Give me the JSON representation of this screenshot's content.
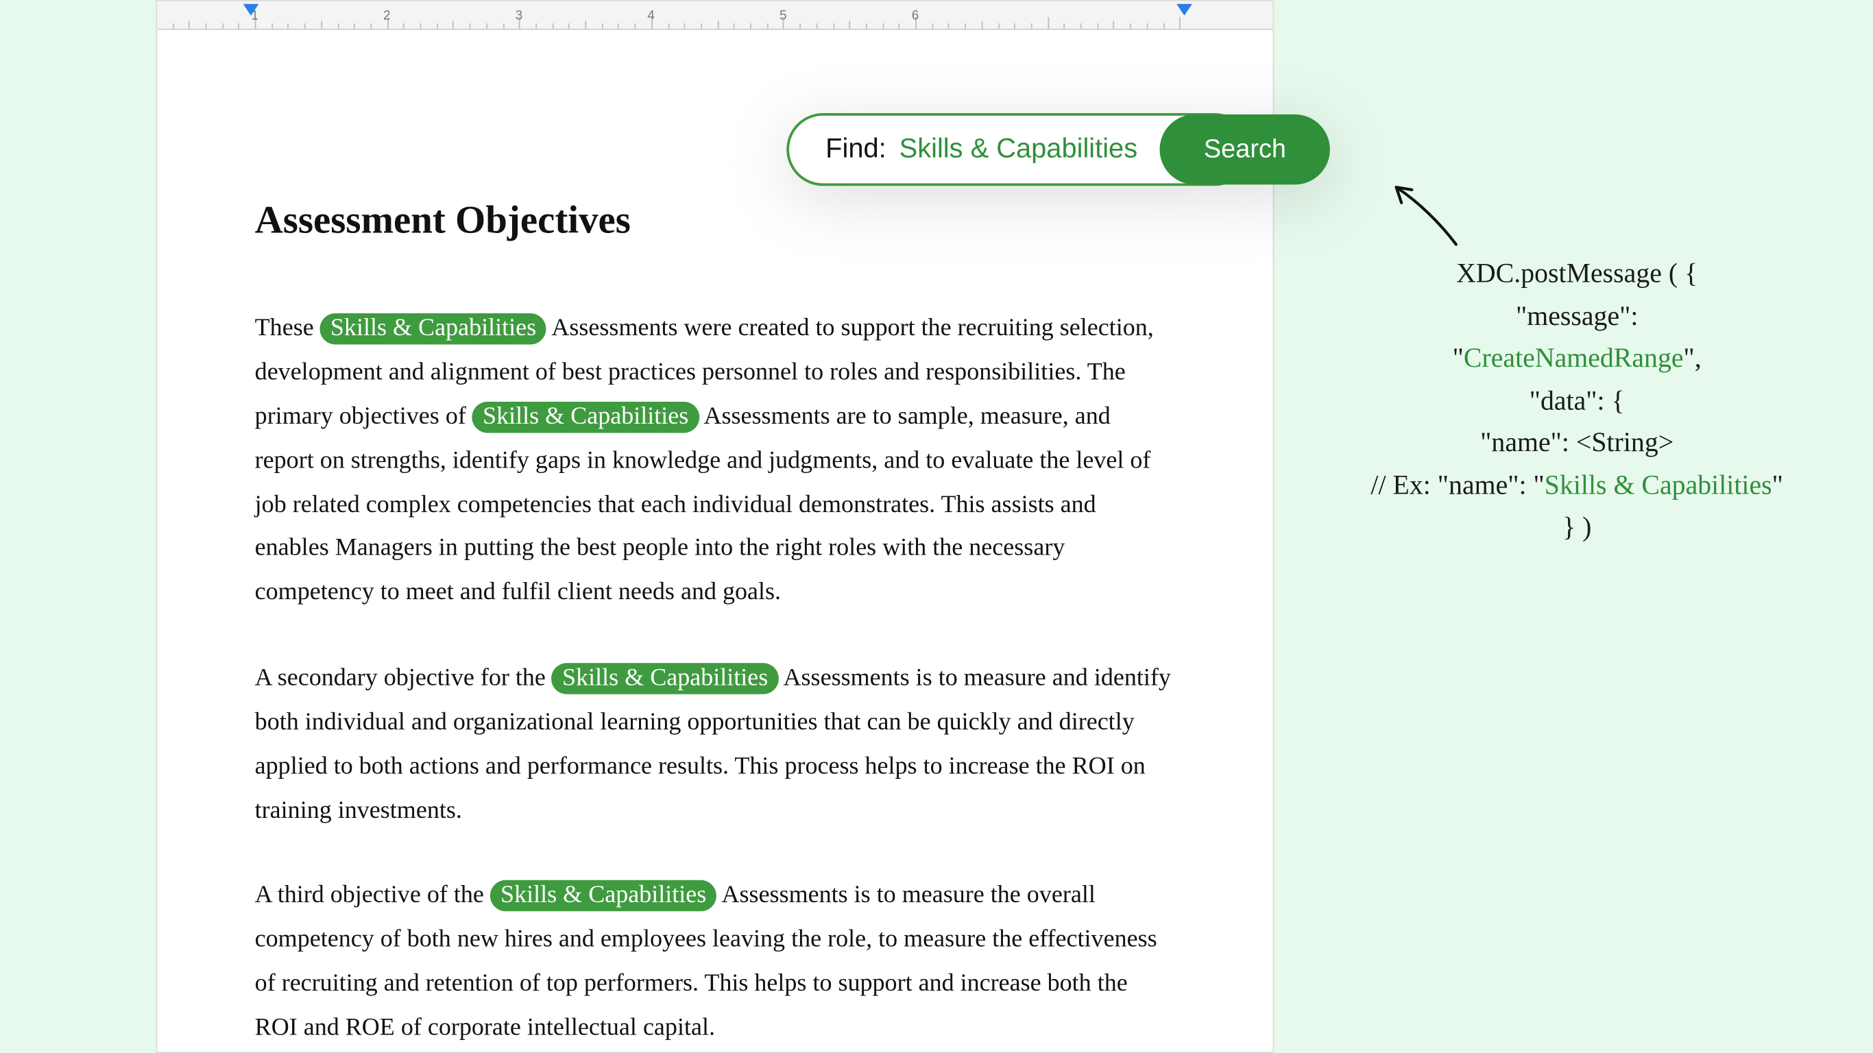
{
  "ruler": {
    "labels": [
      "1",
      "2",
      "3",
      "4",
      "5",
      "6"
    ],
    "left_marker_px": 192,
    "right_marker_px": 910
  },
  "search": {
    "label": "Find:",
    "term": "Skills & Capabilities",
    "button": "Search"
  },
  "document": {
    "title": "Assessment Objectives",
    "highlight": "Skills & Capabilities",
    "p1a": "These ",
    "p1b": " Assessments were created to support the recruiting selection, development and alignment of best practices personnel to roles and responsibilities. The primary objectives of ",
    "p1c": " Assessments are to sample, measure, and report on strengths, identify gaps in knowledge and judgments, and to evaluate the level of job related complex competencies that each individual demonstrates. This assists and enables Managers in putting the best people into the right roles with the necessary competency to meet and fulfil client needs and goals.",
    "p2a": "A secondary objective for the ",
    "p2b": " Assessments is to measure and identify both individual and organizational learning opportunities that can be quickly and directly applied to both actions and performance results. This process helps to increase the ROI on training investments.",
    "p3a": "A third objective of the ",
    "p3b": " Assessments is to measure the overall competency of both new hires and employees leaving the role, to measure the effectiveness of recruiting and retention of top performers. This helps to support and increase both the ROI and ROE of corporate intellectual capital."
  },
  "annotation": {
    "l1a": "XDC.postMessage ( {",
    "l2a": "\"message\":",
    "l3a": "\"",
    "l3b": "CreateNamedRange",
    "l3c": "\",",
    "l4a": "\"data\": {",
    "l5a": "\"name\": <String>",
    "l6a": "// Ex: \"name\": \"",
    "l6b": "Skills & Capabilities",
    "l6c": "\"",
    "l7a": "} )"
  }
}
